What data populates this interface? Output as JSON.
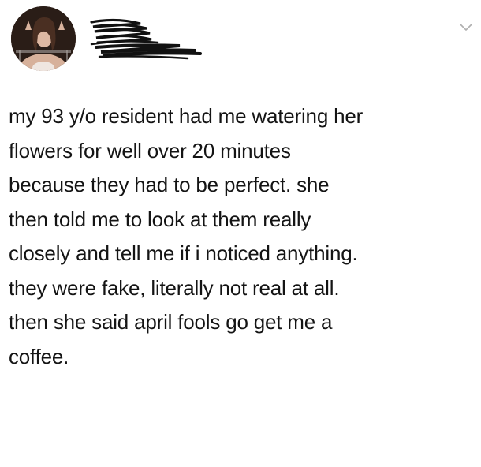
{
  "tweet": {
    "lines": [
      "my 93 y/o resident had me watering her",
      "flowers for well over 20 minutes",
      "because they had to be perfect. she",
      "then told me to look at them really",
      "closely and tell me if i noticed anything.",
      "they were fake, literally not real at all.",
      "then she said april fools go get me a",
      "coffee."
    ]
  },
  "icons": {
    "avatar": "profile-photo",
    "redaction": "scribbled-out-username",
    "menu": "chevron-down-icon"
  },
  "colors": {
    "background": "#ffffff",
    "text": "#141414",
    "chevron": "#b0b0b0",
    "redaction": "#111111"
  }
}
